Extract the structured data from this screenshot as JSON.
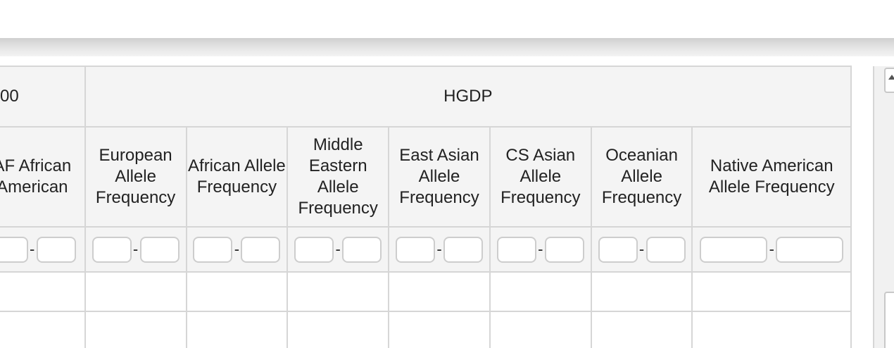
{
  "table": {
    "groups": {
      "g1000": "00",
      "hgdp": "HGDP"
    },
    "columns": {
      "af_african_american": "AF African American",
      "european": "European Allele Frequency",
      "african": "African Allele Frequency",
      "middle_eastern": "Middle Eastern Allele Frequency",
      "east_asian": "East Asian Allele Frequency",
      "cs_asian": "CS Asian Allele Frequency",
      "oceanian": "Oceanian Allele Frequency",
      "native_american": "Native American Allele Frequency"
    },
    "range_separator": "-",
    "filters": {
      "af_african_american": {
        "min": "",
        "max": ""
      },
      "european": {
        "min": "",
        "max": ""
      },
      "african": {
        "min": "",
        "max": ""
      },
      "middle_eastern": {
        "min": "",
        "max": ""
      },
      "east_asian": {
        "min": "",
        "max": ""
      },
      "cs_asian": {
        "min": "",
        "max": ""
      },
      "oceanian": {
        "min": "",
        "max": ""
      },
      "native_american": {
        "min": "",
        "max": ""
      }
    }
  },
  "colors": {
    "header_bg": "#f4f4f4",
    "border": "#d6d6d6",
    "input_border": "#cdcdcd"
  },
  "icons": {
    "scroll_up": "scroll-up-arrow-icon"
  }
}
